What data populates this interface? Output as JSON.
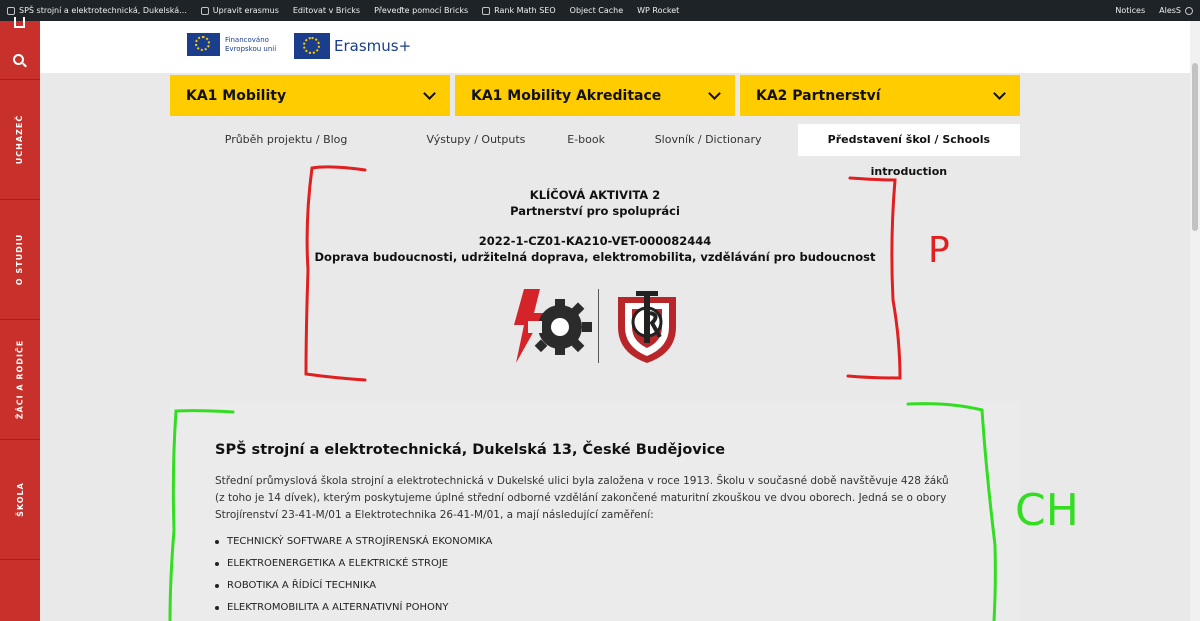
{
  "admin_bar": {
    "site_title": "SPŠ strojní a elektrotechnická, Dukelská...",
    "items": [
      "Upravit erasmus",
      "Editovat v Bricks",
      "Převeďte pomocí Bricks",
      "Rank Math SEO",
      "Object Cache",
      "WP Rocket"
    ],
    "right_items": [
      "Notices",
      "AlesS"
    ]
  },
  "sidebar": {
    "items": [
      "UCHAZEČ",
      "O STUDIU",
      "ŽÁCI A RODIČE",
      "ŠKOLA"
    ]
  },
  "header": {
    "eu_text": "Financováno\nEvropskou unií",
    "erasmus_text": "Erasmus+"
  },
  "ka_buttons": [
    "KA1 Mobility",
    "KA1 Mobility Akreditace",
    "KA2 Partnerství"
  ],
  "tabs": [
    "Průběh projektu / Blog",
    "Výstupy / Outputs",
    "E-book",
    "Slovník / Dictionary",
    "Představení škol / Schools introduction"
  ],
  "ka2": {
    "line1": "KLÍČOVÁ AKTIVITA 2",
    "line2": "Partnerství pro spolupráci",
    "line3": "2022-1-CZ01-KA210-VET-000082444",
    "line4": "Doprava budoucnosti, udržitelná doprava, elektromobilita, vzdělávání pro budoucnost"
  },
  "school_card": {
    "title": "SPŠ strojní a elektrotechnická, Dukelská 13, České Budějovice",
    "body": "Střední průmyslová škola strojní a elektrotechnická v Dukelské ulici byla založena v roce 1913. Školu v současné době navštěvuje 428 žáků (z toho je 14 dívek), kterým poskytujeme úplné střední odborné vzdělání zakončené maturitní zkouškou ve dvou oborech. Jedná se o obory Strojírenství 23-41-M/01 a Elektrotechnika 26-41-M/01, a mají následující zaměření:",
    "list": [
      "TECHNICKÝ SOFTWARE A STROJÍRENSKÁ EKONOMIKA",
      "ELEKTROENERGETIKA A ELEKTRICKÉ STROJE",
      "ROBOTIKA A ŘÍDÍCÍ TECHNIKA",
      "ELEKTROMOBILITA A ALTERNATIVNÍ POHONY"
    ]
  },
  "annotations": {
    "red_label": "P",
    "green_label": "CH"
  },
  "colors": {
    "accent_yellow": "#ffcc00",
    "sidebar_red": "#c8312b",
    "eu_blue": "#1a3e8c",
    "annotation_red": "#e02020",
    "annotation_green": "#33dd22"
  }
}
